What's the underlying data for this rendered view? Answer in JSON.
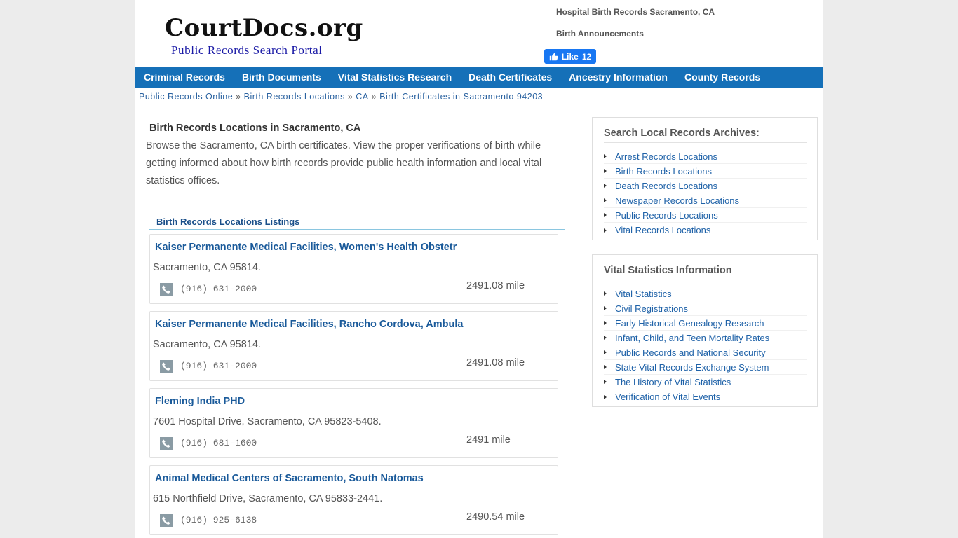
{
  "header": {
    "logo_main": "CourtDocs.org",
    "logo_sub": "Public Records Search Portal",
    "links": [
      "Hospital Birth Records Sacramento, CA",
      "Birth Announcements"
    ],
    "fb_like_label": "Like",
    "fb_like_count": "12"
  },
  "nav": {
    "items": [
      "Criminal Records",
      "Birth Documents",
      "Vital Statistics Research",
      "Death Certificates",
      "Ancestry Information",
      "County Records"
    ]
  },
  "breadcrumb": {
    "items": [
      "Public Records Online",
      "Birth Records Locations",
      "CA",
      "Birth Certificates in Sacramento 94203"
    ],
    "separator": "»"
  },
  "main": {
    "title": "Birth Records Locations in Sacramento, CA",
    "intro": "Browse the Sacramento, CA birth certificates. View the proper verifications of birth while getting informed about how birth records provide public health information and local vital statistics offices.",
    "listings_heading": "Birth Records Locations Listings",
    "listings": [
      {
        "name": "Kaiser Permanente Medical Facilities, Women's Health Obstetr",
        "address": "Sacramento, CA 95814.",
        "phone": "(916) 631-2000",
        "distance": "2491.08 mile"
      },
      {
        "name": "Kaiser Permanente Medical Facilities, Rancho Cordova, Ambula",
        "address": "Sacramento, CA 95814.",
        "phone": "(916) 631-2000",
        "distance": "2491.08 mile"
      },
      {
        "name": "Fleming India PHD",
        "address": "7601 Hospital Drive, Sacramento, CA 95823-5408.",
        "phone": "(916) 681-1600",
        "distance": "2491 mile"
      },
      {
        "name": "Animal Medical Centers of Sacramento, South Natomas",
        "address": "615 Northfield Drive, Sacramento, CA 95833-2441.",
        "phone": "(916) 925-6138",
        "distance": "2490.54 mile"
      }
    ]
  },
  "sidebar": {
    "box1": {
      "title": "Search Local Records Archives:",
      "items": [
        "Arrest Records Locations",
        "Birth Records Locations",
        "Death Records Locations",
        "Newspaper Records Locations",
        "Public Records Locations",
        "Vital Records Locations"
      ]
    },
    "box2": {
      "title": "Vital Statistics Information",
      "items": [
        "Vital Statistics",
        "Civil Registrations",
        "Early Historical Genealogy Research",
        "Infant, Child, and Teen Mortality Rates",
        "Public Records and National Security",
        "State Vital Records Exchange System",
        "The History of Vital Statistics",
        "Verification of Vital Events"
      ]
    }
  },
  "colors": {
    "nav_bg": "#1570b8",
    "link": "#1f62a8",
    "fb_blue": "#1877f2"
  }
}
